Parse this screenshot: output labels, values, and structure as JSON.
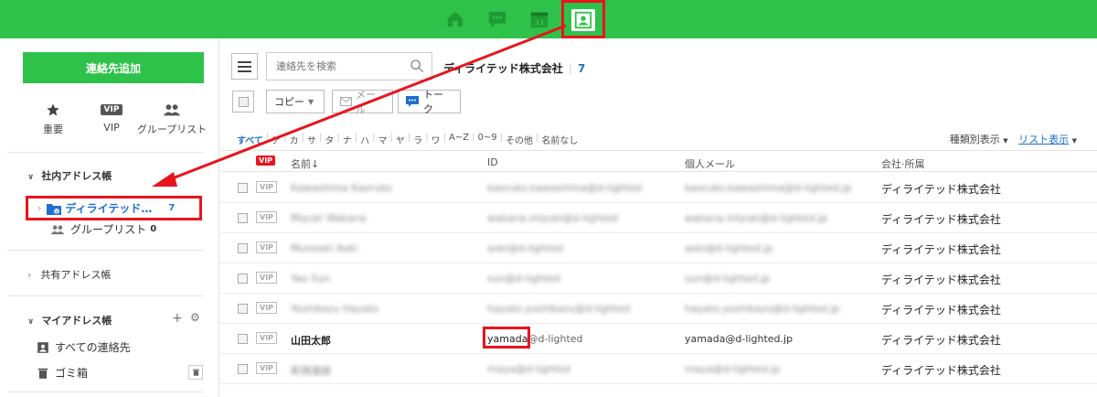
{
  "sidebar": {
    "add_button": "連絡先追加",
    "quick": [
      {
        "label": "重要",
        "icon": "star-icon"
      },
      {
        "label": "VIP",
        "badge": "VIP"
      },
      {
        "label": "グループリスト",
        "icon": "group-icon"
      }
    ],
    "company_book_title": "社内アドレス帳",
    "company_book_item": "ディライテッド…",
    "company_book_count": "7",
    "group_list": "グループリスト",
    "group_list_count": "0",
    "shared_book_title": "共有アドレス帳",
    "my_book_title": "マイアドレス帳",
    "all_contacts": "すべての連絡先",
    "trash": "ゴミ箱"
  },
  "toolbar": {
    "search_placeholder": "連絡先を検索",
    "book_name": "ディライテッド株式会社",
    "book_count": "7",
    "copy": "コピー",
    "mail": "メール",
    "talk": "トーク"
  },
  "index": [
    "すべて",
    "ア",
    "カ",
    "サ",
    "タ",
    "ナ",
    "ハ",
    "マ",
    "ヤ",
    "ラ",
    "ワ",
    "A~Z",
    "0~9",
    "その他",
    "名前なし"
  ],
  "view": {
    "type_view": "種類別表示",
    "list_view": "リスト表示"
  },
  "table": {
    "vip_header": "VIP",
    "headers": [
      "名前↓",
      "ID",
      "個人メール",
      "会社·所属"
    ],
    "rows": [
      {
        "vip": "VIP",
        "name": "Kawashima Kaoruko",
        "id": "kaoruko.kawashima@d-lighted",
        "mail": "kaoruko.kawashima@d-lighted.jp",
        "company": "ディライテッド株式会社",
        "blur": true
      },
      {
        "vip": "VIP",
        "name": "Miyuki Wakana",
        "id": "wakana.miyuki@d-lighted",
        "mail": "wakana.miyuki@d-lighted.jp",
        "company": "ディライテッド株式会社",
        "blur": true
      },
      {
        "vip": "VIP",
        "name": "Muneaki Aoki",
        "id": "aoki@d-lighted",
        "mail": "aoki@d-lighted.jp",
        "company": "ディライテッド株式会社",
        "blur": true
      },
      {
        "vip": "VIP",
        "name": "Yao Sun",
        "id": "sun@d-lighted",
        "mail": "sun@d-lighted.jp",
        "company": "ディライテッド株式会社",
        "blur": true
      },
      {
        "vip": "VIP",
        "name": "Yoshikazu Hayato",
        "id": "hayato.yoshikazu@d-lighted",
        "mail": "hayato.yoshikazu@d-lighted.jp",
        "company": "ディライテッド株式会社",
        "blur": true
      },
      {
        "vip": "VIP",
        "name": "山田太郎",
        "id_highlight": "yamada",
        "id_rest": "@d-lighted",
        "mail": "yamada@d-lighted.jp",
        "company": "ディライテッド株式会社",
        "blur": false
      },
      {
        "vip": "VIP",
        "name": "新規連絡",
        "id": "maya@d-lighted",
        "mail": "maya@d-lighted.jp",
        "company": "ディライテッド株式会社",
        "blur": true
      }
    ]
  }
}
